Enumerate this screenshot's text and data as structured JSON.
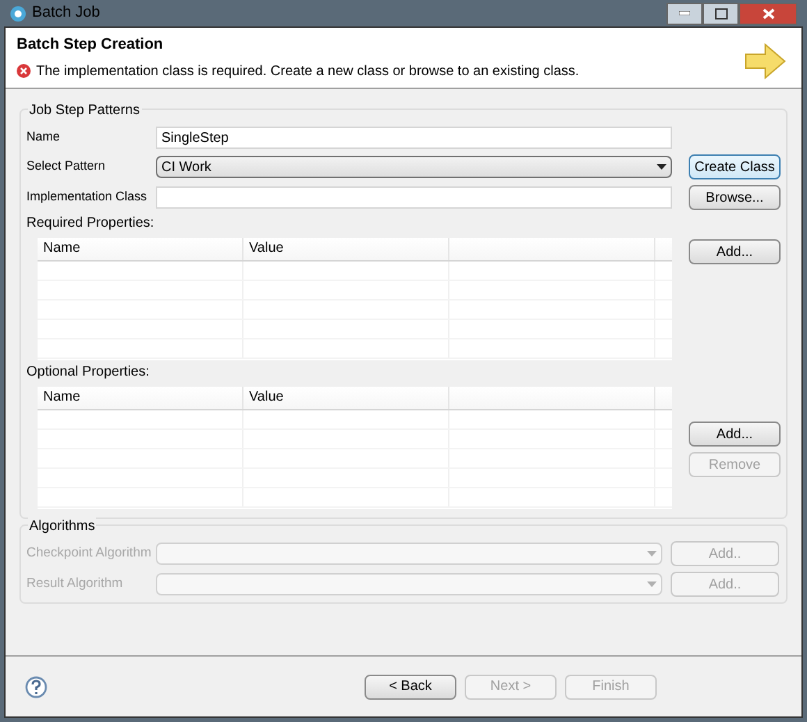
{
  "window": {
    "title": "Batch Job"
  },
  "header": {
    "title": "Batch Step Creation",
    "message": "The implementation class is required. Create a new class or browse to an existing class."
  },
  "job_step_patterns": {
    "title": "Job Step Patterns",
    "fields": [
      {
        "kind": "text",
        "label": "Name",
        "value": "SingleStep"
      },
      {
        "kind": "select",
        "label": "Select Pattern",
        "value": "CI Work",
        "button": {
          "label": "Create Class",
          "focused": true
        }
      },
      {
        "kind": "text",
        "label": "Implementation Class",
        "button": {
          "label": "Browse...",
          "focused": false
        }
      }
    ],
    "tables": [
      {
        "label": "Required Properties:",
        "columns": [
          "Name",
          "Value"
        ],
        "buttons": [
          {
            "label": "Add...",
            "disabled": false
          }
        ]
      },
      {
        "label": "Optional Properties:",
        "columns": [
          "Name",
          "Value"
        ],
        "buttons": [
          {
            "label": "Add...",
            "disabled": false
          },
          {
            "label": "Remove",
            "disabled": true
          }
        ]
      }
    ]
  },
  "algorithms": {
    "title": "Algorithms",
    "rows": [
      {
        "label": "Checkpoint Algorithm",
        "button": "Add..",
        "disabled": true
      },
      {
        "label": "Result Algorithm",
        "button": "Add..",
        "disabled": true
      }
    ]
  },
  "footer": {
    "buttons": [
      {
        "label": "< Back",
        "disabled": false
      },
      {
        "label": "Next >",
        "disabled": true
      },
      {
        "label": "Finish",
        "disabled": true
      }
    ]
  }
}
